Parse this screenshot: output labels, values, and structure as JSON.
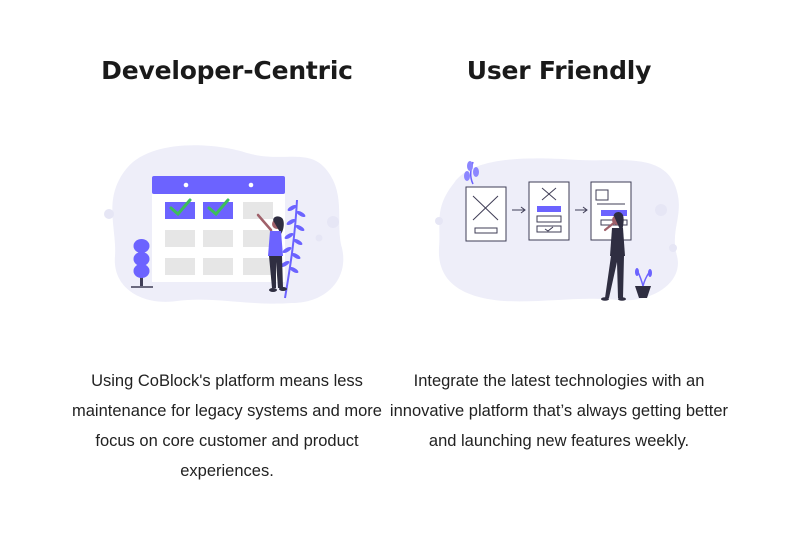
{
  "features": [
    {
      "title": "Developer-Centric",
      "illustration_icon": "calendar-checklist-illustration",
      "description": "Using CoBlock's platform means less maintenance for legacy systems and more focus on core customer and product experiences."
    },
    {
      "title": "User Friendly",
      "illustration_icon": "wireframe-flow-illustration",
      "description": "Integrate the latest technologies with an innovative platform that’s always getting better and launching new features weekly."
    }
  ],
  "colors": {
    "accent": "#6c63ff",
    "blob": "#eeeef9",
    "check": "#3dbe5a",
    "text": "#1c1c1c"
  }
}
